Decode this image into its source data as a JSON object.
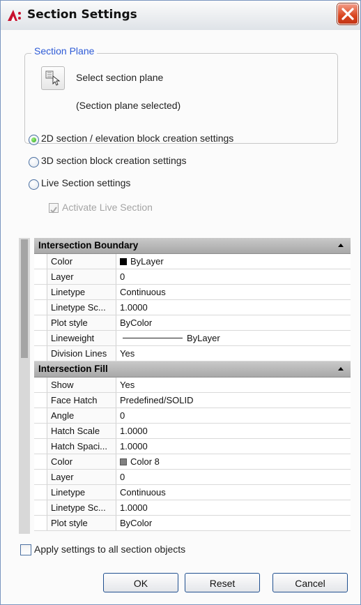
{
  "window": {
    "title": "Section Settings"
  },
  "section_plane": {
    "group_title": "Section Plane",
    "select_label": "Select section plane",
    "status": "(Section plane selected)"
  },
  "options": {
    "radio_2d": "2D section / elevation block creation settings",
    "radio_3d": "3D section block creation settings",
    "radio_live": "Live Section settings",
    "activate_live": "Activate Live Section",
    "selected": "2D"
  },
  "grid": {
    "intersection_boundary": {
      "title": "Intersection Boundary",
      "rows": [
        {
          "key": "Color",
          "value": "ByLayer",
          "swatch": "#000000"
        },
        {
          "key": "Layer",
          "value": "0"
        },
        {
          "key": "Linetype",
          "value": "Continuous"
        },
        {
          "key": "Linetype Sc...",
          "value": "1.0000"
        },
        {
          "key": "Plot style",
          "value": "ByColor"
        },
        {
          "key": "Lineweight",
          "value": "ByLayer"
        },
        {
          "key": "Division Lines",
          "value": "Yes"
        }
      ]
    },
    "intersection_fill": {
      "title": "Intersection Fill",
      "rows": [
        {
          "key": "Show",
          "value": "Yes"
        },
        {
          "key": "Face Hatch",
          "value": "Predefined/SOLID"
        },
        {
          "key": "Angle",
          "value": "0"
        },
        {
          "key": "Hatch Scale",
          "value": "1.0000"
        },
        {
          "key": "Hatch Spaci...",
          "value": "1.0000"
        },
        {
          "key": "Color",
          "value": "Color 8",
          "swatch": "#808080"
        },
        {
          "key": "Layer",
          "value": "0"
        },
        {
          "key": "Linetype",
          "value": "Continuous"
        },
        {
          "key": "Linetype Sc...",
          "value": "1.0000"
        },
        {
          "key": "Plot style",
          "value": "ByColor"
        }
      ]
    }
  },
  "footer": {
    "apply_all": "Apply settings to all section objects",
    "ok": "OK",
    "reset": "Reset",
    "cancel": "Cancel"
  }
}
